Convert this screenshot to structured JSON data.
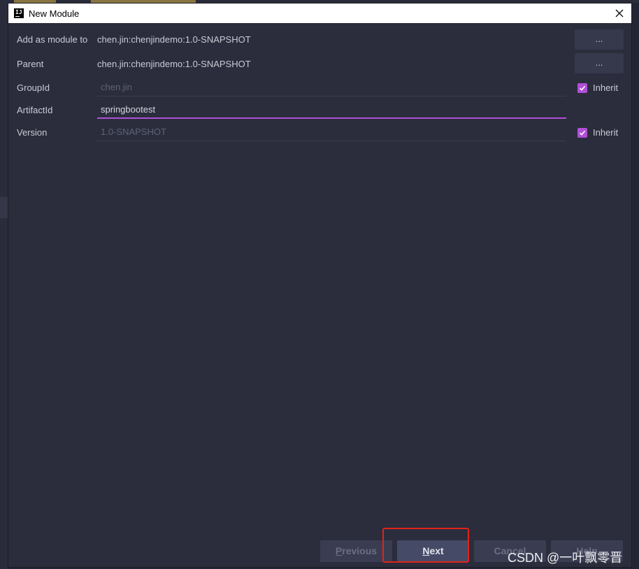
{
  "window": {
    "title": "New Module",
    "close_glyph": "✕"
  },
  "form": {
    "add_as_module_to": {
      "label": "Add as module to",
      "value": "chen.jin:chenjindemo:1.0-SNAPSHOT",
      "button": "..."
    },
    "parent": {
      "label": "Parent",
      "value": "chen.jin:chenjindemo:1.0-SNAPSHOT",
      "button": "..."
    },
    "group_id": {
      "label": "GroupId",
      "value": "chen.jin",
      "inherit_label": "Inherit",
      "inherit_checked": true
    },
    "artifact_id": {
      "label": "ArtifactId",
      "value": "springbootest"
    },
    "version": {
      "label": "Version",
      "value": "1.0-SNAPSHOT",
      "inherit_label": "Inherit",
      "inherit_checked": true
    }
  },
  "footer": {
    "previous": {
      "mnemonic": "P",
      "rest": "revious"
    },
    "next": {
      "mnemonic": "N",
      "rest": "ext"
    },
    "cancel": "Cancel",
    "help": "Help"
  },
  "watermark": "CSDN @一叶飘零晋",
  "colors": {
    "accent": "#b04fd8",
    "highlight": "#e0241b",
    "dialog_bg": "#2b2d3c"
  }
}
